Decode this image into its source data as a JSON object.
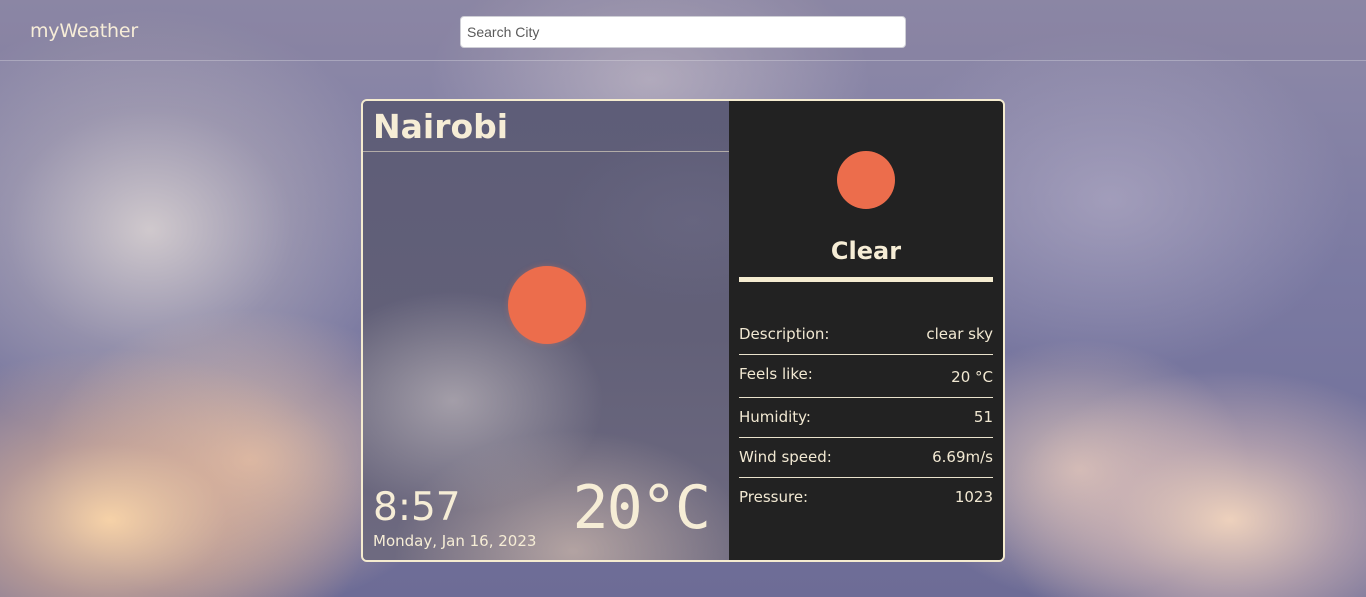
{
  "navbar": {
    "brand": "myWeather",
    "search_placeholder": "Search City"
  },
  "card": {
    "city": "Nairobi",
    "time": "8:57",
    "date": "Monday, Jan 16, 2023",
    "temperature": "20°C",
    "weather_icon": "sun-icon",
    "condition": "Clear",
    "details": [
      {
        "label": "Description:",
        "value": "clear sky"
      },
      {
        "label": "Feels like:",
        "value": "20 °C"
      },
      {
        "label": "Humidity:",
        "value": "51"
      },
      {
        "label": "Wind speed:",
        "value": "6.69m/s"
      },
      {
        "label": "Pressure:",
        "value": "1023"
      }
    ]
  },
  "colors": {
    "accent": "#f5ecd0",
    "sun": "#ec6d4c",
    "panel_dark": "#222222"
  }
}
